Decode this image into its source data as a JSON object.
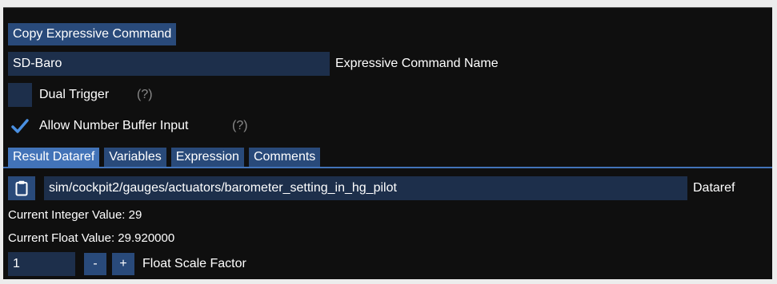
{
  "copy_button_label": "Copy Expressive Command",
  "command_name": {
    "value": "SD-Baro",
    "label": "Expressive Command Name"
  },
  "dual_trigger": {
    "label": "Dual Trigger",
    "help": "(?)",
    "checked": false
  },
  "allow_number_buffer": {
    "label": "Allow Number Buffer Input",
    "help": "(?)",
    "checked": true
  },
  "tabs": [
    {
      "label": "Result Dataref",
      "active": true
    },
    {
      "label": "Variables",
      "active": false
    },
    {
      "label": "Expression",
      "active": false
    },
    {
      "label": "Comments",
      "active": false
    }
  ],
  "dataref": {
    "icon": "clipboard-icon",
    "value": "sim/cockpit2/gauges/actuators/barometer_setting_in_hg_pilot",
    "label": "Dataref"
  },
  "current_integer": "Current Integer Value: 29",
  "current_float": "Current Float Value: 29.920000",
  "scale": {
    "value": "1",
    "minus_label": "-",
    "plus_label": "+",
    "label": "Float Scale Factor"
  },
  "colors": {
    "button": "#294a7a",
    "field": "#1d2f4b",
    "tab_active": "#4273b8",
    "check": "#4a90e2"
  }
}
